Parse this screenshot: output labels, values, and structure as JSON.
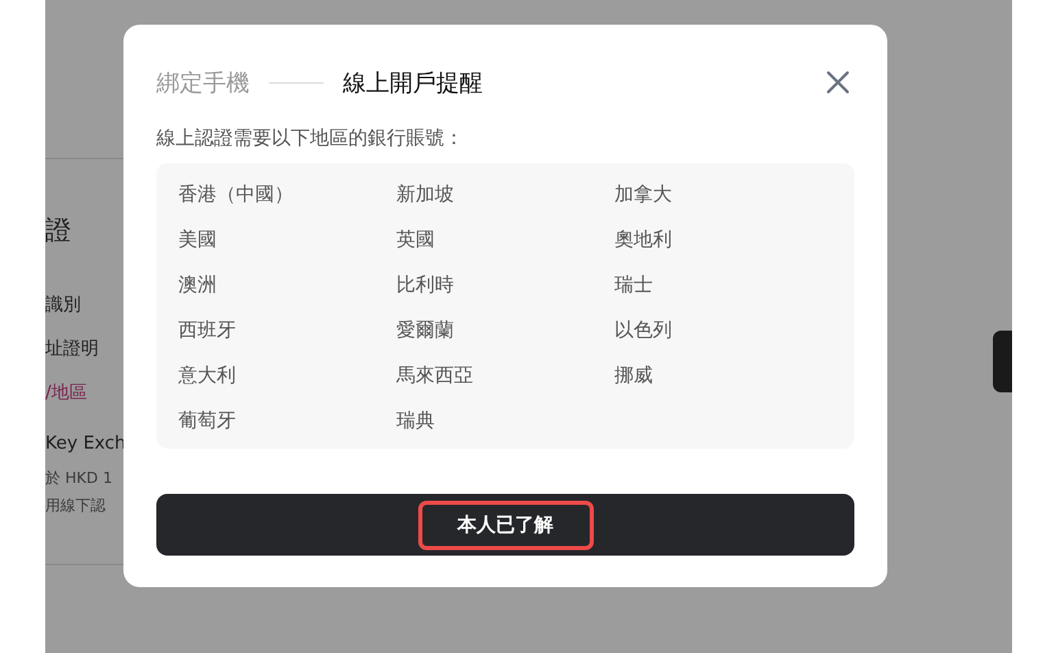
{
  "background_page": {
    "heading": "證",
    "items": [
      {
        "label": "識別",
        "kind": "plain"
      },
      {
        "label": "址證明",
        "kind": "plain"
      },
      {
        "label": "/地區",
        "kind": "accent"
      }
    ],
    "account_title": "Key Exch",
    "notes": [
      "於 HKD 1",
      "用線下認"
    ]
  },
  "dialog": {
    "steps": [
      {
        "label": "綁定手機",
        "selected": false
      },
      {
        "label": "線上開戶提醒",
        "selected": true
      }
    ],
    "intro": "線上認證需要以下地區的銀行賬號：",
    "regions": [
      "香港（中國）",
      "新加坡",
      "加拿大",
      "美國",
      "英國",
      "奧地利",
      "澳洲",
      "比利時",
      "瑞士",
      "西班牙",
      "愛爾蘭",
      "以色列",
      "意大利",
      "馬來西亞",
      "挪威",
      "葡萄牙",
      "瑞典"
    ],
    "confirm_button": {
      "label": "本人已了解",
      "highlighted": true
    }
  }
}
